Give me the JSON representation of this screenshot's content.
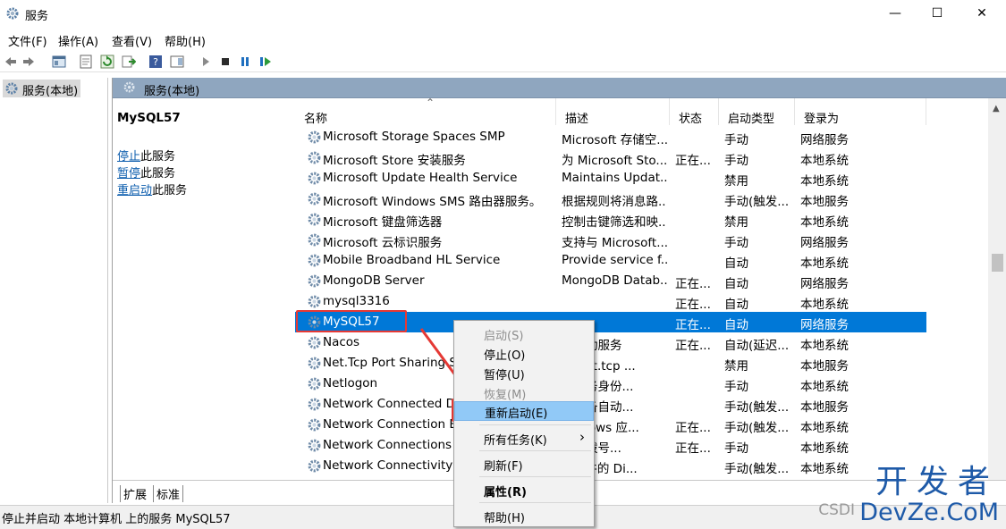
{
  "window": {
    "title": "服务",
    "minimize": "—",
    "maximize": "☐",
    "close": "✕"
  },
  "menu": [
    "文件(F)",
    "操作(A)",
    "查看(V)",
    "帮助(H)"
  ],
  "left_pane": {
    "item": "服务(本地)"
  },
  "header": {
    "title": "服务(本地)"
  },
  "detail": {
    "service_name": "MySQL57",
    "actions": [
      {
        "link": "停止",
        "rest": "此服务"
      },
      {
        "link": "暂停",
        "rest": "此服务"
      },
      {
        "link": "重启动",
        "rest": "此服务"
      }
    ]
  },
  "columns": [
    "名称",
    "描述",
    "状态",
    "启动类型",
    "登录为"
  ],
  "sort_indicator": "⌃",
  "rows": [
    {
      "name": "Microsoft Storage Spaces SMP",
      "desc": "Microsoft 存储空...",
      "status": "",
      "startup": "手动",
      "logon": "网络服务"
    },
    {
      "name": "Microsoft Store 安装服务",
      "desc": "为 Microsoft Sto...",
      "status": "正在...",
      "startup": "手动",
      "logon": "本地系统"
    },
    {
      "name": "Microsoft Update Health Service",
      "desc": "Maintains Updat...",
      "status": "",
      "startup": "禁用",
      "logon": "本地系统"
    },
    {
      "name": "Microsoft Windows SMS 路由器服务。",
      "desc": "根据规则将消息路...",
      "status": "",
      "startup": "手动(触发...",
      "logon": "本地服务"
    },
    {
      "name": "Microsoft 键盘筛选器",
      "desc": "控制击键筛选和映...",
      "status": "",
      "startup": "禁用",
      "logon": "本地系统"
    },
    {
      "name": "Microsoft 云标识服务",
      "desc": "支持与 Microsoft...",
      "status": "",
      "startup": "手动",
      "logon": "网络服务"
    },
    {
      "name": "Mobile Broadband HL Service",
      "desc": "Provide service f...",
      "status": "",
      "startup": "自动",
      "logon": "本地系统"
    },
    {
      "name": "MongoDB Server",
      "desc": "MongoDB Datab...",
      "status": "正在...",
      "startup": "自动",
      "logon": "网络服务"
    },
    {
      "name": "mysql3316",
      "desc": "",
      "status": "正在...",
      "startup": "自动",
      "logon": "本地系统"
    },
    {
      "name": "MySQL57",
      "desc": "",
      "status": "正在...",
      "startup": "自动",
      "logon": "网络服务"
    },
    {
      "name": "Nacos",
      "desc": "自启动服务",
      "status": "正在...",
      "startup": "自动(延迟...",
      "logon": "本地系统"
    },
    {
      "name": "Net.Tcp Port Sharing S",
      "desc": "过 net.tcp ...",
      "status": "",
      "startup": "禁用",
      "logon": "本地服务"
    },
    {
      "name": "Netlogon",
      "desc": "和服务身份...",
      "status": "",
      "startup": "手动",
      "logon": "本地系统"
    },
    {
      "name": "Network Connected De",
      "desc": "接设备自动...",
      "status": "",
      "startup": "手动(触发...",
      "logon": "本地服务"
    },
    {
      "name": "Network Connection Br",
      "desc": "Vindows 应...",
      "status": "正在...",
      "startup": "手动(触发...",
      "logon": "本地系统"
    },
    {
      "name": "Network Connections",
      "desc": "络和拨号...",
      "status": "正在...",
      "startup": "手动",
      "logon": "本地系统"
    },
    {
      "name": "Network Connectivity A",
      "desc": "1 组件的 Di...",
      "status": "",
      "startup": "手动(触发...",
      "logon": "本地系统"
    }
  ],
  "selected_row": "MySQL57",
  "context_menu": [
    {
      "label": "启动(S)",
      "state": "disabled"
    },
    {
      "label": "停止(O)",
      "state": "normal"
    },
    {
      "label": "暂停(U)",
      "state": "normal"
    },
    {
      "label": "恢复(M)",
      "state": "disabled"
    },
    {
      "label": "重新启动(E)",
      "state": "highlighted"
    },
    {
      "label": "所有任务(K)",
      "state": "submenu",
      "arrow": "›"
    },
    {
      "label": "刷新(F)",
      "state": "normal"
    },
    {
      "label": "属性(R)",
      "state": "bold"
    },
    {
      "label": "帮助(H)",
      "state": "normal"
    }
  ],
  "tabs": [
    "扩展",
    "标准"
  ],
  "status_text": "停止并启动 本地计算机 上的服务 MySQL57",
  "watermark": {
    "top": "开发者",
    "bottom": "DevZe.CoM",
    "csdn": "CSDI"
  },
  "colors": {
    "selection": "#0078d7",
    "header_bar": "#8fa6bf",
    "highlight": "#91c9f7",
    "annotation_red": "#e53935",
    "watermark": "#1e5aa8"
  }
}
